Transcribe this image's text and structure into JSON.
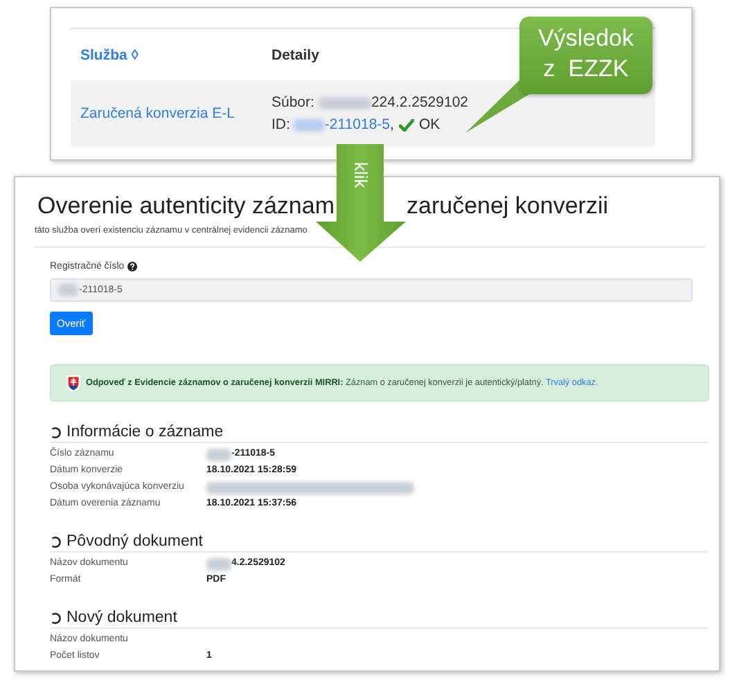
{
  "results_table": {
    "columns": [
      {
        "label": "Služba",
        "sort_icon": "◊",
        "link": true
      },
      {
        "label": "Detaily",
        "link": false
      }
    ],
    "rows": [
      {
        "service": "Zaručená konverzia E-L",
        "file_label": "Súbor:",
        "file_redacted": true,
        "file_name": "224.2.2529102",
        "id_label": "ID:",
        "id_redacted": true,
        "id": "-211018-5",
        "separator": ",",
        "verified": true,
        "status": "OK"
      }
    ]
  },
  "callout": {
    "lines": [
      "Výsledok",
      "z  EZZK"
    ]
  },
  "arrow": {
    "label": "klik"
  },
  "verification_page": {
    "title_parts": [
      "Overenie autenticity záznam",
      "zaručenej konverzii"
    ],
    "subtitle": "táto služba overí existenciu záznamu v centrálnej evidencii záznamo",
    "field": {
      "label": "Registračné číslo",
      "help": true,
      "value_redacted": true,
      "value": "-211018-5"
    },
    "submit": "Overiť",
    "alert": {
      "emblem": true,
      "message": "**Odpoveď z Evidencie záznamov o zaručenej konverzii MIRRI:** Záznam o zaručenej konverzii je autentický/platný.",
      "link": "Trvalý odkaz."
    },
    "sections": [
      {
        "title": "Informácie o zázname",
        "rows": [
          {
            "label": "Číslo záznamu",
            "redacted": true,
            "value": "-211018-5"
          },
          {
            "label": "Dátum konverzie",
            "redacted": false,
            "value": "18.10.2021 15:28:59"
          },
          {
            "label": "Osoba vykonávajúca konverziu",
            "redacted": true
          },
          {
            "label": "Dátum overenia záznamu",
            "redacted": false,
            "value": "18.10.2021 15:37:56"
          }
        ]
      },
      {
        "title": "Pôvodný dokument",
        "rows": [
          {
            "label": "Názov dokumentu",
            "redacted": true,
            "value": "4.2.2529102"
          },
          {
            "label": "Formát",
            "redacted": false,
            "value": "PDF"
          }
        ]
      },
      {
        "title": "Nový dokument",
        "rows": [
          {
            "label": "Názov dokumentu",
            "redacted": false
          },
          {
            "label": "Počet listov",
            "redacted": false,
            "value": "1"
          }
        ]
      }
    ]
  }
}
